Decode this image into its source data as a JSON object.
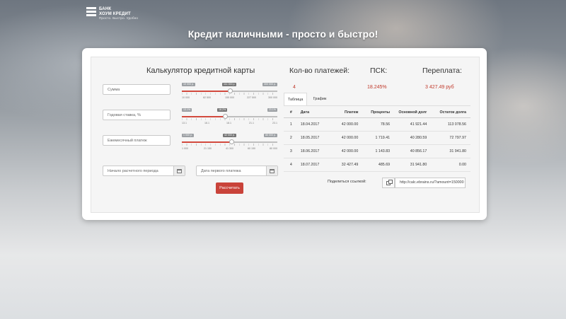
{
  "brand": {
    "line1": "БАНК",
    "line2": "ХОУМ КРЕДИТ",
    "tagline": "Просто. Быстро. Удобно"
  },
  "headline": "Кредит наличными - просто и быстро!",
  "calculator": {
    "title": "Калькулятор кредитной карты",
    "fields": {
      "amount": "Сумма",
      "rate": "Годовая ставка, %",
      "payment": "Ежемесячный платеж",
      "start": "Начало расчетного периода",
      "first_payment": "Дата первого платежа"
    },
    "sliders": {
      "amount": {
        "min_tag": "10 000 р.",
        "cur_tag": "111 000 р.",
        "max_tag": "300 000 р.",
        "value_fraction": 0.5,
        "ticks": [
          "10 000",
          "82 500",
          "155 000",
          "227 500",
          "300 000"
        ]
      },
      "rate": {
        "min_tag": "13.1%",
        "cur_tag": "18.2%",
        "max_tag": "23.1%",
        "value_fraction": 0.45,
        "ticks": [
          "13.1",
          "16.1",
          "18.1",
          "21.1",
          "23.1"
        ]
      },
      "payment": {
        "min_tag": "1 000 р.",
        "cur_tag": "42 000 р.",
        "max_tag": "80 000 р.",
        "value_fraction": 0.52,
        "ticks": [
          "1 000",
          "21 150",
          "41 300",
          "60 150",
          "80 000"
        ]
      }
    },
    "submit_label": "Рассчитать"
  },
  "stats": {
    "payments_title": "Кол-во платежей:",
    "payments_value": "4",
    "psk_title": "ПСК:",
    "psk_value": "18.245%",
    "overpay_title": "Переплата:",
    "overpay_value": "3 427.49 руб"
  },
  "tabs": {
    "table": "Таблица",
    "chart": "График"
  },
  "schedule": {
    "headers": [
      "#",
      "Дата",
      "Платеж",
      "Проценты",
      "Основной долг",
      "Остаток долга"
    ],
    "rows": [
      [
        "1",
        "18.04.2017",
        "42 000.00",
        "78.56",
        "41 921.44",
        "113 078.56"
      ],
      [
        "2",
        "18.05.2017",
        "42 000.00",
        "1 719.41",
        "40 280.59",
        "72 797.97"
      ],
      [
        "3",
        "18.06.2017",
        "42 000.00",
        "1 143.83",
        "40 856.17",
        "31 941.80"
      ],
      [
        "4",
        "18.07.2017",
        "32 427.49",
        "485.69",
        "31 941.80",
        "0.00"
      ]
    ]
  },
  "share": {
    "label": "Поделиться ссылкой:",
    "url": "http://calc.ebrains.ru/?amount=150000"
  }
}
